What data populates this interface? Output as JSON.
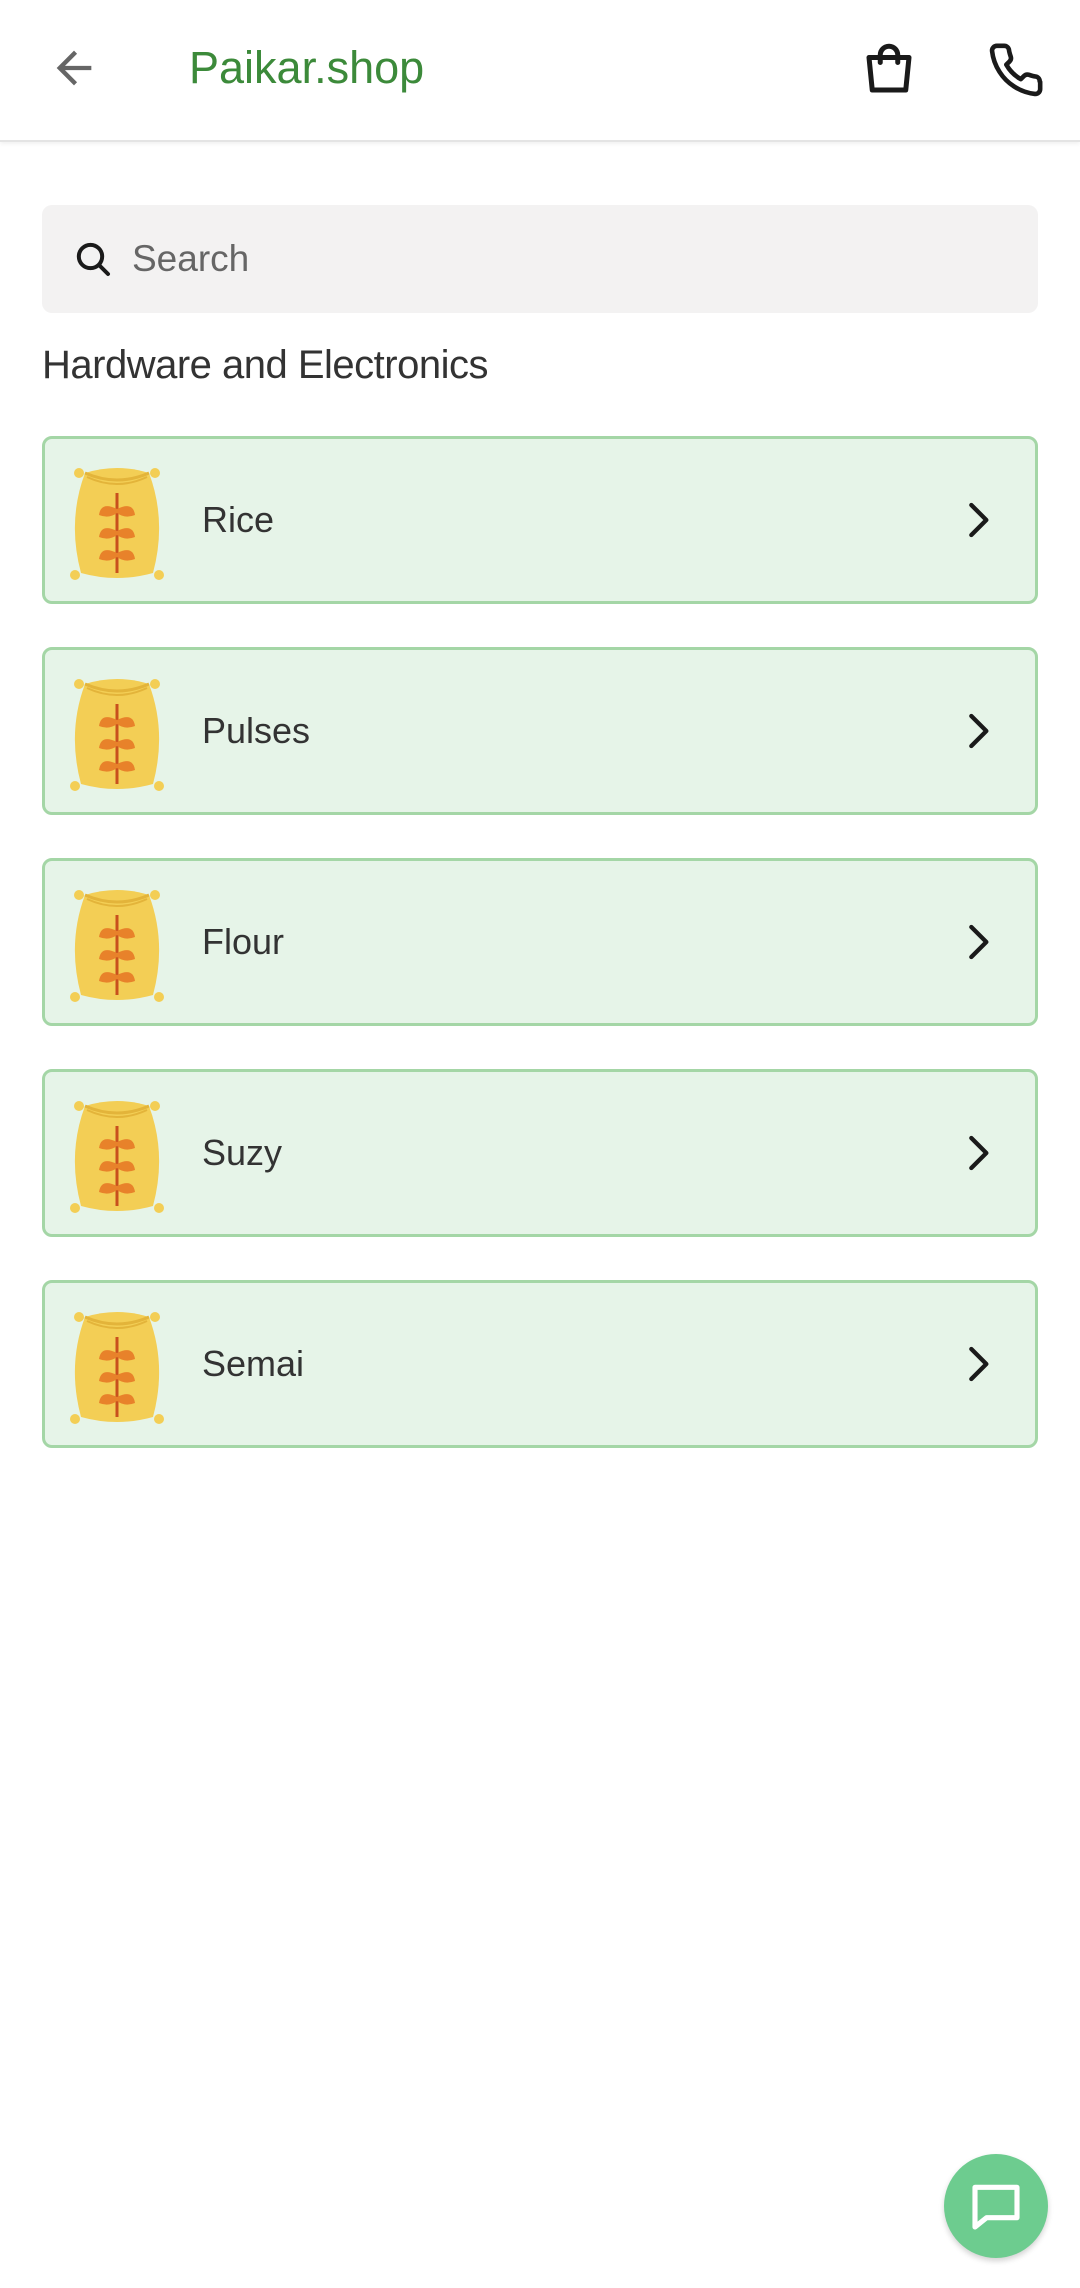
{
  "app_bar": {
    "title": "Paikar.shop",
    "back_icon": "arrow-left-icon",
    "cart_icon": "shopping-bag-icon",
    "call_icon": "phone-icon",
    "title_color": "#3c8a3a"
  },
  "search": {
    "placeholder": "Search",
    "value": "",
    "icon": "search-icon"
  },
  "section": {
    "title": "Hardware and Electronics"
  },
  "categories": [
    {
      "label": "Rice",
      "icon": "grain-sack-icon"
    },
    {
      "label": "Pulses",
      "icon": "grain-sack-icon"
    },
    {
      "label": "Flour",
      "icon": "grain-sack-icon"
    },
    {
      "label": "Suzy",
      "icon": "grain-sack-icon"
    },
    {
      "label": "Semai",
      "icon": "grain-sack-icon"
    }
  ],
  "fab": {
    "icon": "chat-icon",
    "color": "#6dcc8f"
  },
  "colors": {
    "item_background": "#e6f4e8",
    "item_border": "#a4d6a6",
    "sack_yellow": "#f3ce55",
    "wheat_orange": "#e8822a"
  }
}
